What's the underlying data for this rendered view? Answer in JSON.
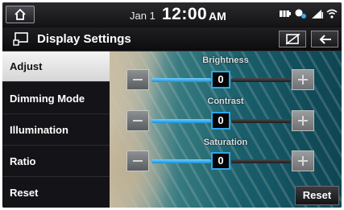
{
  "status_bar": {
    "date": "Jan 1",
    "time": "12:00",
    "ampm": "AM",
    "icons": [
      "home-icon",
      "battery-icon",
      "bluetooth-gps-icon",
      "signal-icon",
      "wifi-icon"
    ]
  },
  "title_bar": {
    "icon": "display-icon",
    "title": "Display Settings",
    "buttons": [
      "screen-off-icon",
      "back-arrow-icon"
    ]
  },
  "sidebar": {
    "items": [
      {
        "label": "Adjust",
        "active": true
      },
      {
        "label": "Dimming Mode",
        "active": false
      },
      {
        "label": "Illumination",
        "active": false
      },
      {
        "label": "Ratio",
        "active": false
      },
      {
        "label": "Reset",
        "active": false
      }
    ]
  },
  "adjust": {
    "sliders": [
      {
        "label": "Brightness",
        "value": "0"
      },
      {
        "label": "Contrast",
        "value": "0"
      },
      {
        "label": "Saturation",
        "value": "0"
      }
    ],
    "reset_label": "Reset"
  },
  "colors": {
    "accent": "#2ea7ee",
    "slider_fill": "#1b8fd6",
    "active_menu_bg": "#e8e8e8"
  }
}
